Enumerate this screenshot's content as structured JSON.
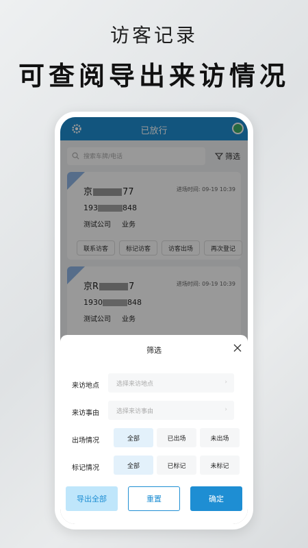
{
  "headline": {
    "line1": "访客记录",
    "line2": "可查阅导出来访情况"
  },
  "app": {
    "title": "已放行",
    "search_placeholder": "搜索车牌/电话",
    "filter_label": "筛选",
    "accent": "#1e8ed3"
  },
  "records": [
    {
      "plate_prefix": "京",
      "plate_suffix": "77",
      "time_label": "进场时间: 09-19 10:39",
      "phone_prefix": "193",
      "phone_suffix": "848",
      "company": "测试公司",
      "reason": "业务"
    },
    {
      "plate_prefix": "京R",
      "plate_suffix": "7",
      "time_label": "进场时间: 09-19 10:39",
      "phone_prefix": "1930",
      "phone_suffix": "848",
      "company": "测试公司",
      "reason": "业务"
    }
  ],
  "record_actions": [
    "联系访客",
    "标记访客",
    "访客出场",
    "再次登记"
  ],
  "filter_sheet": {
    "title": "筛选",
    "location": {
      "label": "来访地点",
      "placeholder": "选择来访地点"
    },
    "reason": {
      "label": "来访事由",
      "placeholder": "选择来访事由"
    },
    "exit_status": {
      "label": "出场情况",
      "options": [
        "全部",
        "已出场",
        "未出场"
      ],
      "selected": "全部"
    },
    "mark_status": {
      "label": "标记情况",
      "options": [
        "全部",
        "已标记",
        "未标记"
      ],
      "selected": "全部"
    },
    "buttons": {
      "export": "导出全部",
      "reset": "重置",
      "confirm": "确定"
    }
  }
}
